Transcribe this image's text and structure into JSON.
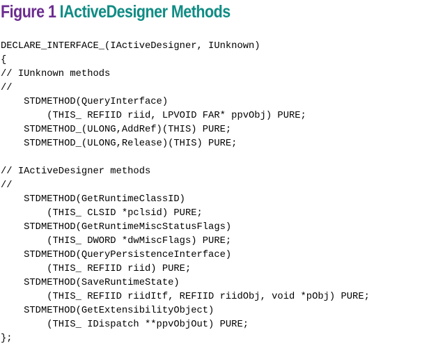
{
  "figure": {
    "label": "Figure 1",
    "name": "IActiveDesigner Methods",
    "label_color": "#6b2c8f",
    "name_color": "#0f8c84"
  },
  "code_lines": [
    "DECLARE_INTERFACE_(IActiveDesigner, IUnknown)",
    "{",
    "// IUnknown methods",
    "//",
    "    STDMETHOD(QueryInterface)",
    "        (THIS_ REFIID riid, LPVOID FAR* ppvObj) PURE;",
    "    STDMETHOD_(ULONG,AddRef)(THIS) PURE;",
    "    STDMETHOD_(ULONG,Release)(THIS) PURE;",
    "",
    "// IActiveDesigner methods",
    "//",
    "    STDMETHOD(GetRuntimeClassID)",
    "        (THIS_ CLSID *pclsid) PURE;",
    "    STDMETHOD(GetRuntimeMiscStatusFlags)",
    "        (THIS_ DWORD *dwMiscFlags) PURE;",
    "    STDMETHOD(QueryPersistenceInterface)",
    "        (THIS_ REFIID riid) PURE;",
    "    STDMETHOD(SaveRuntimeState)",
    "        (THIS_ REFIID riidItf, REFIID riidObj, void *pObj) PURE;",
    "    STDMETHOD(GetExtensibilityObject)",
    "        (THIS_ IDispatch **ppvObjOut) PURE;",
    "};"
  ]
}
